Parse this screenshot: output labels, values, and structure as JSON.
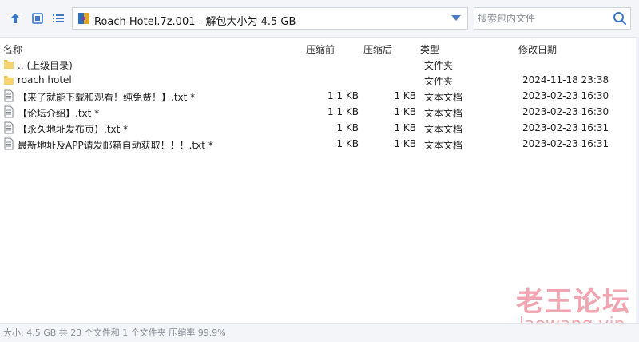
{
  "toolbar": {
    "path_text": "Roach Hotel.7z.001 - 解包大小为 4.5 GB",
    "search_placeholder": "搜索包内文件",
    "icons": {
      "up": "arrow-up-icon",
      "view_large": "view-large-icon",
      "view_list": "view-list-icon",
      "archive": "archive-icon",
      "dropdown": "dropdown-icon",
      "search": "search-icon"
    },
    "accent_color": "#3a78c6"
  },
  "columns": {
    "name": "名称",
    "packed": "压缩前",
    "unpacked": "压缩后",
    "type": "类型",
    "date": "修改日期"
  },
  "rows": [
    {
      "icon": "folder-icon",
      "name": ".. (上级目录)",
      "packed": "",
      "unpacked": "",
      "type": "文件夹",
      "date": ""
    },
    {
      "icon": "folder-icon",
      "name": "roach hotel",
      "packed": "",
      "unpacked": "",
      "type": "文件夹",
      "date": "2024-11-18 23:38"
    },
    {
      "icon": "text-file-icon",
      "name": "【来了就能下载和观看！纯免费！】.txt *",
      "packed": "1.1 KB",
      "unpacked": "1 KB",
      "type": "文本文档",
      "date": "2023-02-23 16:30"
    },
    {
      "icon": "text-file-icon",
      "name": "【论坛介绍】.txt *",
      "packed": "1.1 KB",
      "unpacked": "1 KB",
      "type": "文本文档",
      "date": "2023-02-23 16:30"
    },
    {
      "icon": "text-file-icon",
      "name": "【永久地址发布页】.txt *",
      "packed": "1 KB",
      "unpacked": "1 KB",
      "type": "文本文档",
      "date": "2023-02-23 16:31"
    },
    {
      "icon": "text-file-icon",
      "name": "最新地址及APP请发邮箱自动获取！！！.txt *",
      "packed": "1 KB",
      "unpacked": "1 KB",
      "type": "文本文档",
      "date": "2023-02-23 16:31"
    }
  ],
  "status": {
    "text": "大小: 4.5 GB 共 23 个文件和 1 个文件夹 压缩率 99.9%"
  },
  "watermark": {
    "cn": "老王论坛",
    "en": "laowang.vip",
    "color": "#f2a4b0"
  }
}
